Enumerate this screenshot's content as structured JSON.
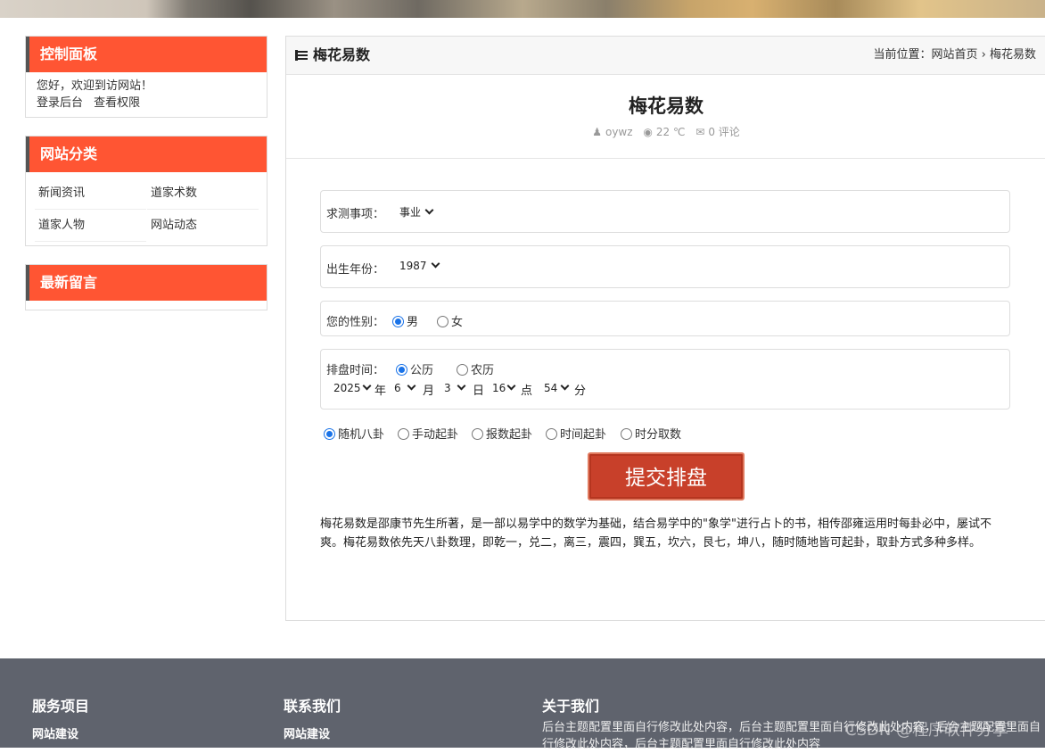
{
  "sidebar": {
    "control_panel": {
      "title": "控制面板",
      "welcome": "您好，欢迎到访网站！",
      "links": [
        "登录后台",
        "查看权限"
      ]
    },
    "categories": {
      "title": "网站分类",
      "items": [
        "新闻资讯",
        "道家术数",
        "道家人物",
        "网站动态"
      ]
    },
    "latest_comments": {
      "title": "最新留言"
    }
  },
  "main": {
    "header_title": "梅花易数",
    "breadcrumb": "当前位置：网站首页 › 梅花易数",
    "article_title": "梅花易数",
    "meta": {
      "author": "oywz",
      "views": "22 ℃",
      "comments": "0 评论"
    },
    "form": {
      "matter_label": "求测事项：",
      "matter_value": "事业",
      "birth_year_label": "出生年份：",
      "birth_year_value": "1987",
      "gender_label": "您的性别：",
      "gender_options": [
        "男",
        "女"
      ],
      "gender_selected": "男",
      "time_label": "排盘时间：",
      "calendar_options": [
        "公历",
        "农历"
      ],
      "calendar_selected": "公历",
      "year_value": "2025",
      "year_unit": "年",
      "month_value": "6",
      "month_unit": "月",
      "day_value": "3",
      "day_unit": "日",
      "hour_value": "16",
      "hour_unit": "点",
      "minute_value": "54",
      "minute_unit": "分",
      "method_options": [
        "随机八卦",
        "手动起卦",
        "报数起卦",
        "时间起卦",
        "时分取数"
      ],
      "method_selected": "随机八卦",
      "submit_label": "提交排盘"
    },
    "description": "梅花易数是邵康节先生所著，是一部以易学中的数学为基础，结合易学中的\"象学\"进行占卜的书，相传邵雍运用时每卦必中，屡试不爽。梅花易数依先天八卦数理，即乾一，兑二，离三，震四，巽五，坎六，艮七，坤八，随时随地皆可起卦，取卦方式多种多样。"
  },
  "footer": {
    "services_title": "服务项目",
    "services_link": "网站建设",
    "contact_title": "联系我们",
    "contact_link": "网站建设",
    "about_title": "关于我们",
    "about_text": "后台主题配置里面自行修改此处内容，后台主题配置里面自行修改此处内容，后台主题配置里面自行修改此处内容，后台主题配置里面自行修改此处内容",
    "watermark": "CSDN @程序软件分享"
  },
  "colors": {
    "accent": "#ff5533",
    "submit": "#c8402a",
    "footer_bg": "#5f636d"
  }
}
